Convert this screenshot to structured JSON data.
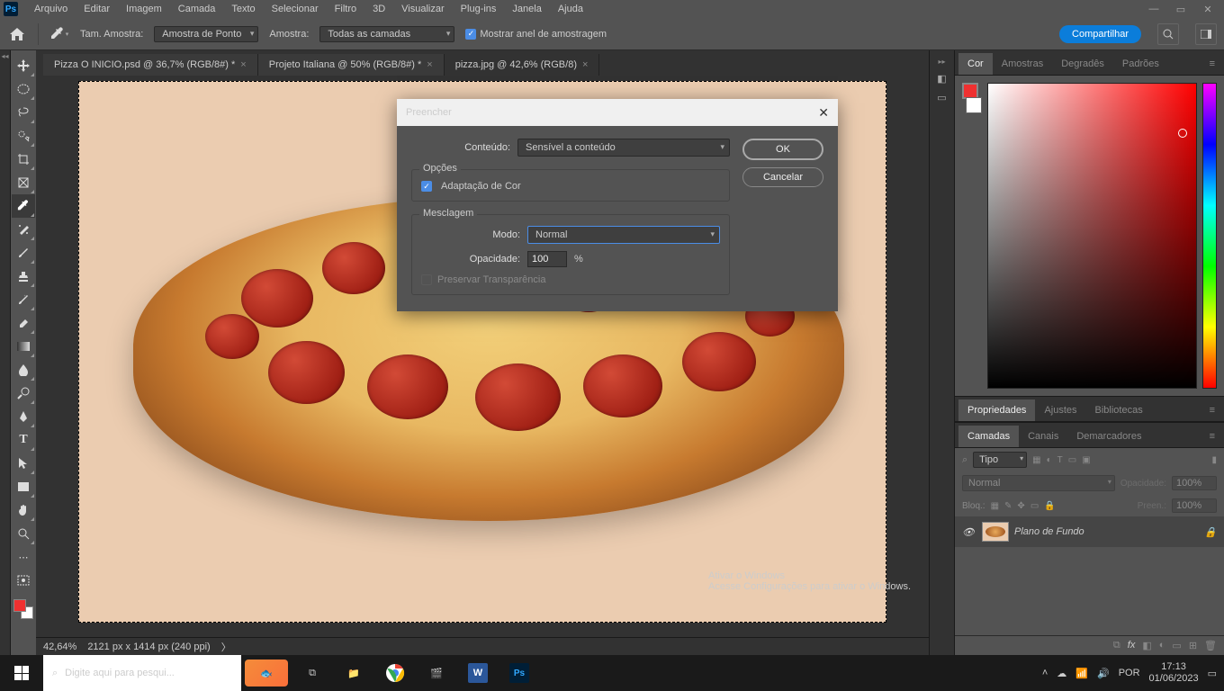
{
  "menubar": [
    "Arquivo",
    "Editar",
    "Imagem",
    "Camada",
    "Texto",
    "Selecionar",
    "Filtro",
    "3D",
    "Visualizar",
    "Plug-ins",
    "Janela",
    "Ajuda"
  ],
  "options": {
    "sample_size_label": "Tam. Amostra:",
    "sample_size_value": "Amostra de Ponto",
    "sample_label": "Amostra:",
    "sample_value": "Todas as camadas",
    "ring_label": "Mostrar anel de amostragem",
    "share": "Compartilhar"
  },
  "tabs": [
    {
      "label": "Pizza O INICIO.psd @ 36,7% (RGB/8#) *",
      "active": false
    },
    {
      "label": "Projeto Italiana @ 50% (RGB/8#) *",
      "active": false
    },
    {
      "label": "pizza.jpg @ 42,6% (RGB/8)",
      "active": true
    }
  ],
  "status": {
    "zoom": "42,64%",
    "doc": "2121 px x 1414 px (240 ppi)"
  },
  "dialog": {
    "title": "Preencher",
    "content_label": "Conteúdo:",
    "content_value": "Sensível a conteúdo",
    "ok": "OK",
    "cancel": "Cancelar",
    "options_legend": "Opções",
    "color_adapt": "Adaptação de Cor",
    "blend_legend": "Mesclagem",
    "mode_label": "Modo:",
    "mode_value": "Normal",
    "opacity_label": "Opacidade:",
    "opacity_value": "100",
    "opacity_unit": "%",
    "preserve": "Preservar Transparência"
  },
  "panels": {
    "color_tabs": [
      "Cor",
      "Amostras",
      "Degradês",
      "Padrões"
    ],
    "prop_tabs": [
      "Propriedades",
      "Ajustes",
      "Bibliotecas"
    ],
    "layer_tabs": [
      "Camadas",
      "Canais",
      "Demarcadores"
    ],
    "layer_filter_ph": "Tipo",
    "blend_mode": "Normal",
    "opacity_lbl": "Opacidade:",
    "opacity_val": "100%",
    "lock_lbl": "Bloq.:",
    "fill_lbl": "Preen.:",
    "fill_val": "100%",
    "layer_name": "Plano de Fundo"
  },
  "watermark": {
    "l1": "Ativar o Windows",
    "l2": "Acesse Configurações para ativar o Windows."
  },
  "taskbar": {
    "search": "Digite aqui para pesqui...",
    "lang": "POR",
    "time": "17:13",
    "date": "01/06/2023"
  }
}
